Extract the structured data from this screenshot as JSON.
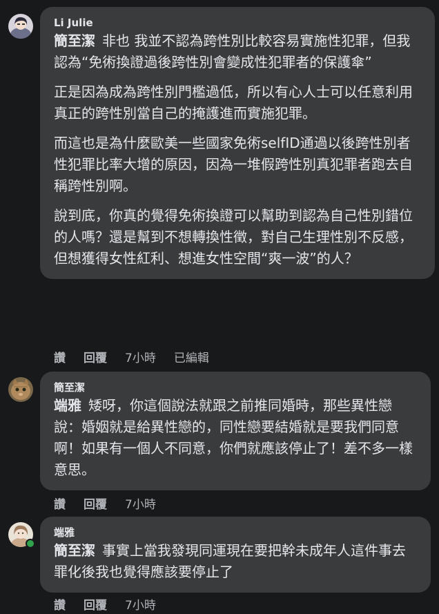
{
  "comments": [
    {
      "author": "Li Julie",
      "paragraphs": [
        {
          "mention": "簡至潔",
          "text": "非也 我並不認為跨性別比較容易實施性犯罪，但我認為“免術換證過後跨性別會變成性犯罪者的保護傘”"
        },
        {
          "mention": "",
          "text": "正是因為成為跨性別門檻過低，所以有心人士可以任意利用真正的跨性別當自己的掩護進而實施犯罪。"
        },
        {
          "mention": "",
          "text": "而這也是為什麼歐美一些國家免術selfID通過以後跨性別者性犯罪比率大增的原因，因為一堆假跨性別真犯罪者跑去自稱跨性別啊。"
        },
        {
          "mention": "",
          "text": "說到底，你真的覺得免術換證可以幫助到認為自己性別錯位的人嗎？還是幫到不想轉換性徵，對自己生理性別不反感，但想獲得女性紅利、想進女性空間“爽一波”的人？"
        }
      ],
      "actions": {
        "like": "讚",
        "reply": "回覆",
        "time": "7小時",
        "edited": "已編輯"
      }
    },
    {
      "author": "簡至潔",
      "paragraphs": [
        {
          "mention": "端雅",
          "text": "矮呀，你這個說法就跟之前推同婚時，那些異性戀說：婚姻就是給異性戀的，同性戀要結婚就是要我們同意啊！如果有一個人不同意，你們就應該停止了！差不多一樣意思。"
        }
      ],
      "actions": {
        "like": "讚",
        "reply": "回覆",
        "time": "7小時"
      }
    },
    {
      "author": "端雅",
      "paragraphs": [
        {
          "mention": "簡至潔",
          "text": "事實上當我發現同運現在要把幹未成年人這件事去罪化後我也覺得應該要停止了"
        }
      ],
      "actions": {
        "like": "讚",
        "reply": "回覆",
        "time": "7小時"
      }
    }
  ],
  "colors": {
    "background": "#18191a",
    "bubble": "#3a3b3c",
    "text": "#e4e6eb",
    "meta": "#b0b3b8",
    "online": "#31a24c"
  }
}
